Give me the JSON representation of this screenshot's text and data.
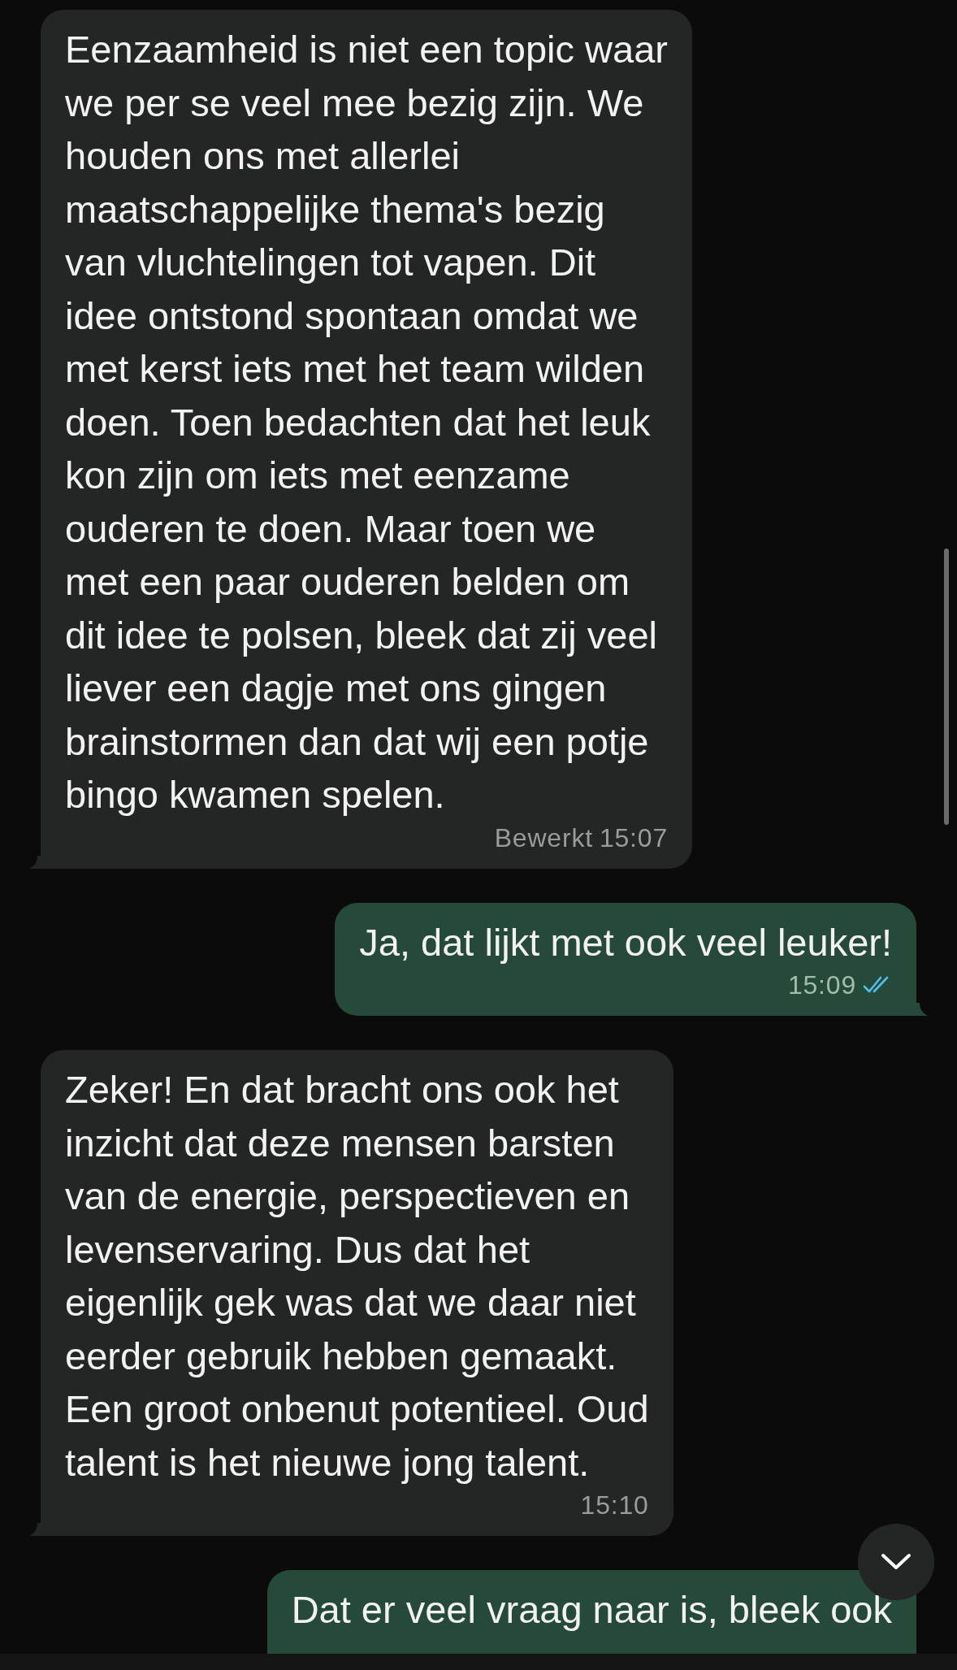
{
  "messages": [
    {
      "kind": "incoming",
      "lines": [
        "Eenzaamheid is niet een topic waar",
        "we per se veel mee bezig zijn. We",
        "houden ons met allerlei",
        "maatschappelijke thema's bezig",
        "van vluchtelingen tot vapen. Dit",
        "idee ontstond spontaan omdat we",
        "met kerst iets met het team wilden",
        "doen. Toen bedachten dat het leuk",
        "kon zijn om iets met eenzame",
        "ouderen te doen. Maar toen we",
        "met een paar ouderen belden om",
        "dit idee te polsen, bleek dat zij veel",
        "liever een dagje met ons gingen",
        "brainstormen dan dat wij een potje",
        "bingo kwamen spelen."
      ],
      "edited_label": "Bewerkt",
      "time": "15:07"
    },
    {
      "kind": "outgoing",
      "lines": [
        "Ja, dat lijkt met ook veel leuker!"
      ],
      "time": "15:09",
      "read": true
    },
    {
      "kind": "incoming",
      "lines": [
        "Zeker! En dat bracht ons ook het",
        "inzicht dat deze mensen barsten",
        "van de energie, perspectieven en",
        "levenservaring. Dus dat het",
        "eigenlijk gek was dat we daar niet",
        "eerder gebruik hebben gemaakt.",
        "Een groot onbenut potentieel. Oud",
        "talent is het nieuwe jong talent."
      ],
      "time": "15:10"
    },
    {
      "kind": "outgoing",
      "lines": [
        "Dat er veel vraag naar is, bleek ook"
      ]
    }
  ]
}
